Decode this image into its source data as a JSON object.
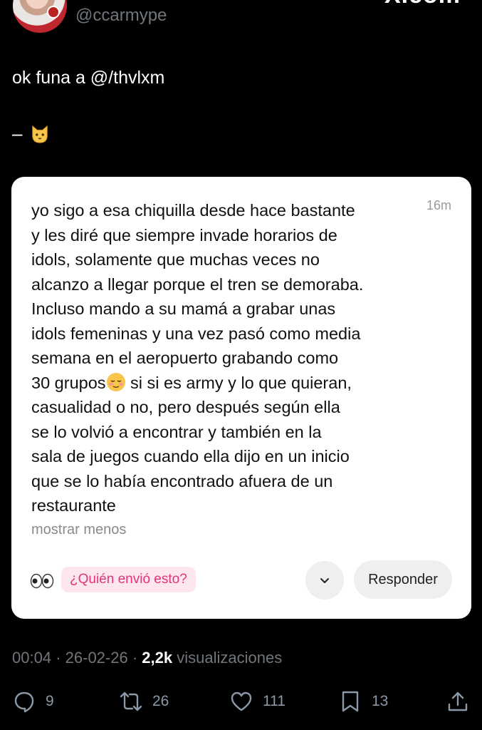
{
  "header": {
    "handle": "@ccarmype"
  },
  "tweet": {
    "text": "ok funa a @/thvlxm",
    "dash": "–"
  },
  "card": {
    "time": "16m",
    "message": "yo sigo a esa chiquilla desde hace bastante\ny les diré que siempre invade horarios de\nidols, solamente que muchas veces no\nalcanzo a llegar porque el tren se demoraba.\nIncluso mando a su mamá a grabar unas\nidols femeninas y una vez pasó como media\nsemana en el aeropuerto grabando como\n30 grupos",
    "message_cont": " si si es army y lo que quieran,\ncasualidad o no, pero después según ella\nse lo volvió a encontrar  y también en la\nsala de juegos cuando ella dijo en un inicio\nque se lo había encontrado afuera de un\nrestaurante",
    "show_less": "mostrar menos",
    "who_sent": "¿Quién envió esto?",
    "reply_label": "Responder"
  },
  "meta": {
    "time": "00:04",
    "date": "26-02-26",
    "views_count": "2,2k",
    "views_label": "visualizaciones"
  },
  "actions": {
    "replies": "9",
    "retweets": "26",
    "likes": "111",
    "bookmarks": "13"
  }
}
